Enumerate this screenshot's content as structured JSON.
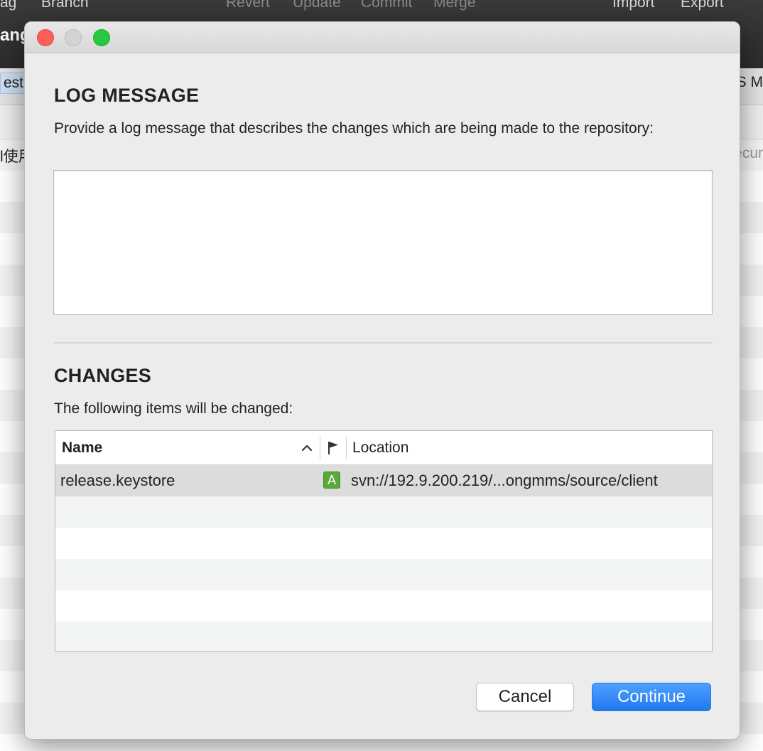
{
  "background": {
    "toolbar_items": [
      "ag",
      "Branch",
      "Revert",
      "Update",
      "Commit",
      "Merge",
      "Import",
      "Export"
    ],
    "title_fragment": "ang",
    "tag_fragment": "est i",
    "tag_right_fragment": "S M",
    "row_text_fragment": "l使用",
    "row_text_right_fragment": "ecur"
  },
  "dialog": {
    "log_section": {
      "title": "LOG MESSAGE",
      "description": "Provide a log message that describes the changes which are being made to the repository:",
      "message_value": "",
      "message_placeholder": ""
    },
    "changes_section": {
      "title": "CHANGES",
      "description": "The following items will be changed:",
      "columns": {
        "name": "Name",
        "location": "Location"
      },
      "rows": [
        {
          "name": "release.keystore",
          "status": "A",
          "location": "svn://192.9.200.219/...ongmms/source/client"
        }
      ]
    },
    "buttons": {
      "cancel": "Cancel",
      "continue": "Continue"
    }
  },
  "colors": {
    "accent": "#1f78f0",
    "status_added": "#5aa83a",
    "close": "#fe5f57",
    "zoom": "#28c840"
  }
}
